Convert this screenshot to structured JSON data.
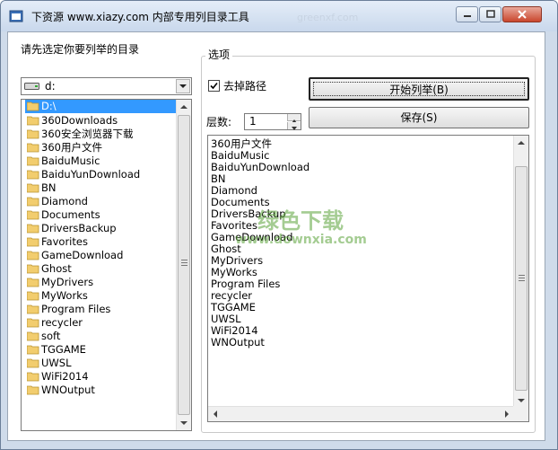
{
  "window": {
    "title": "下资源 www.xiazy.com 内部专用列目录工具",
    "faint_bg_text": "greenxf.com"
  },
  "left": {
    "prompt_label": "请先选定你要列举的目录",
    "drive": {
      "value": "d:",
      "icon": "drive-icon"
    },
    "tree_root": "D:\\",
    "folders": [
      "360Downloads",
      "360安全浏览器下载",
      "360用户文件",
      "BaiduMusic",
      "BaiduYunDownload",
      "BN",
      "Diamond",
      "Documents",
      "DriversBackup",
      "Favorites",
      "GameDownload",
      "Ghost",
      "MyDrivers",
      "MyWorks",
      "Program Files",
      "recycler",
      "soft",
      "TGGAME",
      "UWSL",
      "WiFi2014",
      "WNOutput"
    ]
  },
  "options": {
    "group_title": "选项",
    "remove_path_label": "去掉路径",
    "remove_path_checked": true,
    "start_button": "开始列举(B)",
    "save_button": "保存(S)",
    "level_label": "层数:",
    "level_value": "1"
  },
  "output_lines": [
    "360用户文件",
    "BaiduMusic",
    "BaiduYunDownload",
    "BN",
    "Diamond",
    "Documents",
    "DriversBackup",
    "Favorites",
    "GameDownload",
    "Ghost",
    "MyDrivers",
    "MyWorks",
    "Program Files",
    "recycler",
    "TGGAME",
    "UWSL",
    "WiFi2014",
    "WNOutput"
  ],
  "watermark": {
    "line1": "绿色下载",
    "line2": "www.downxia.com"
  },
  "colors": {
    "selection": "#3399ff",
    "folder": "#f2cd6e",
    "close": "#c9462d"
  }
}
